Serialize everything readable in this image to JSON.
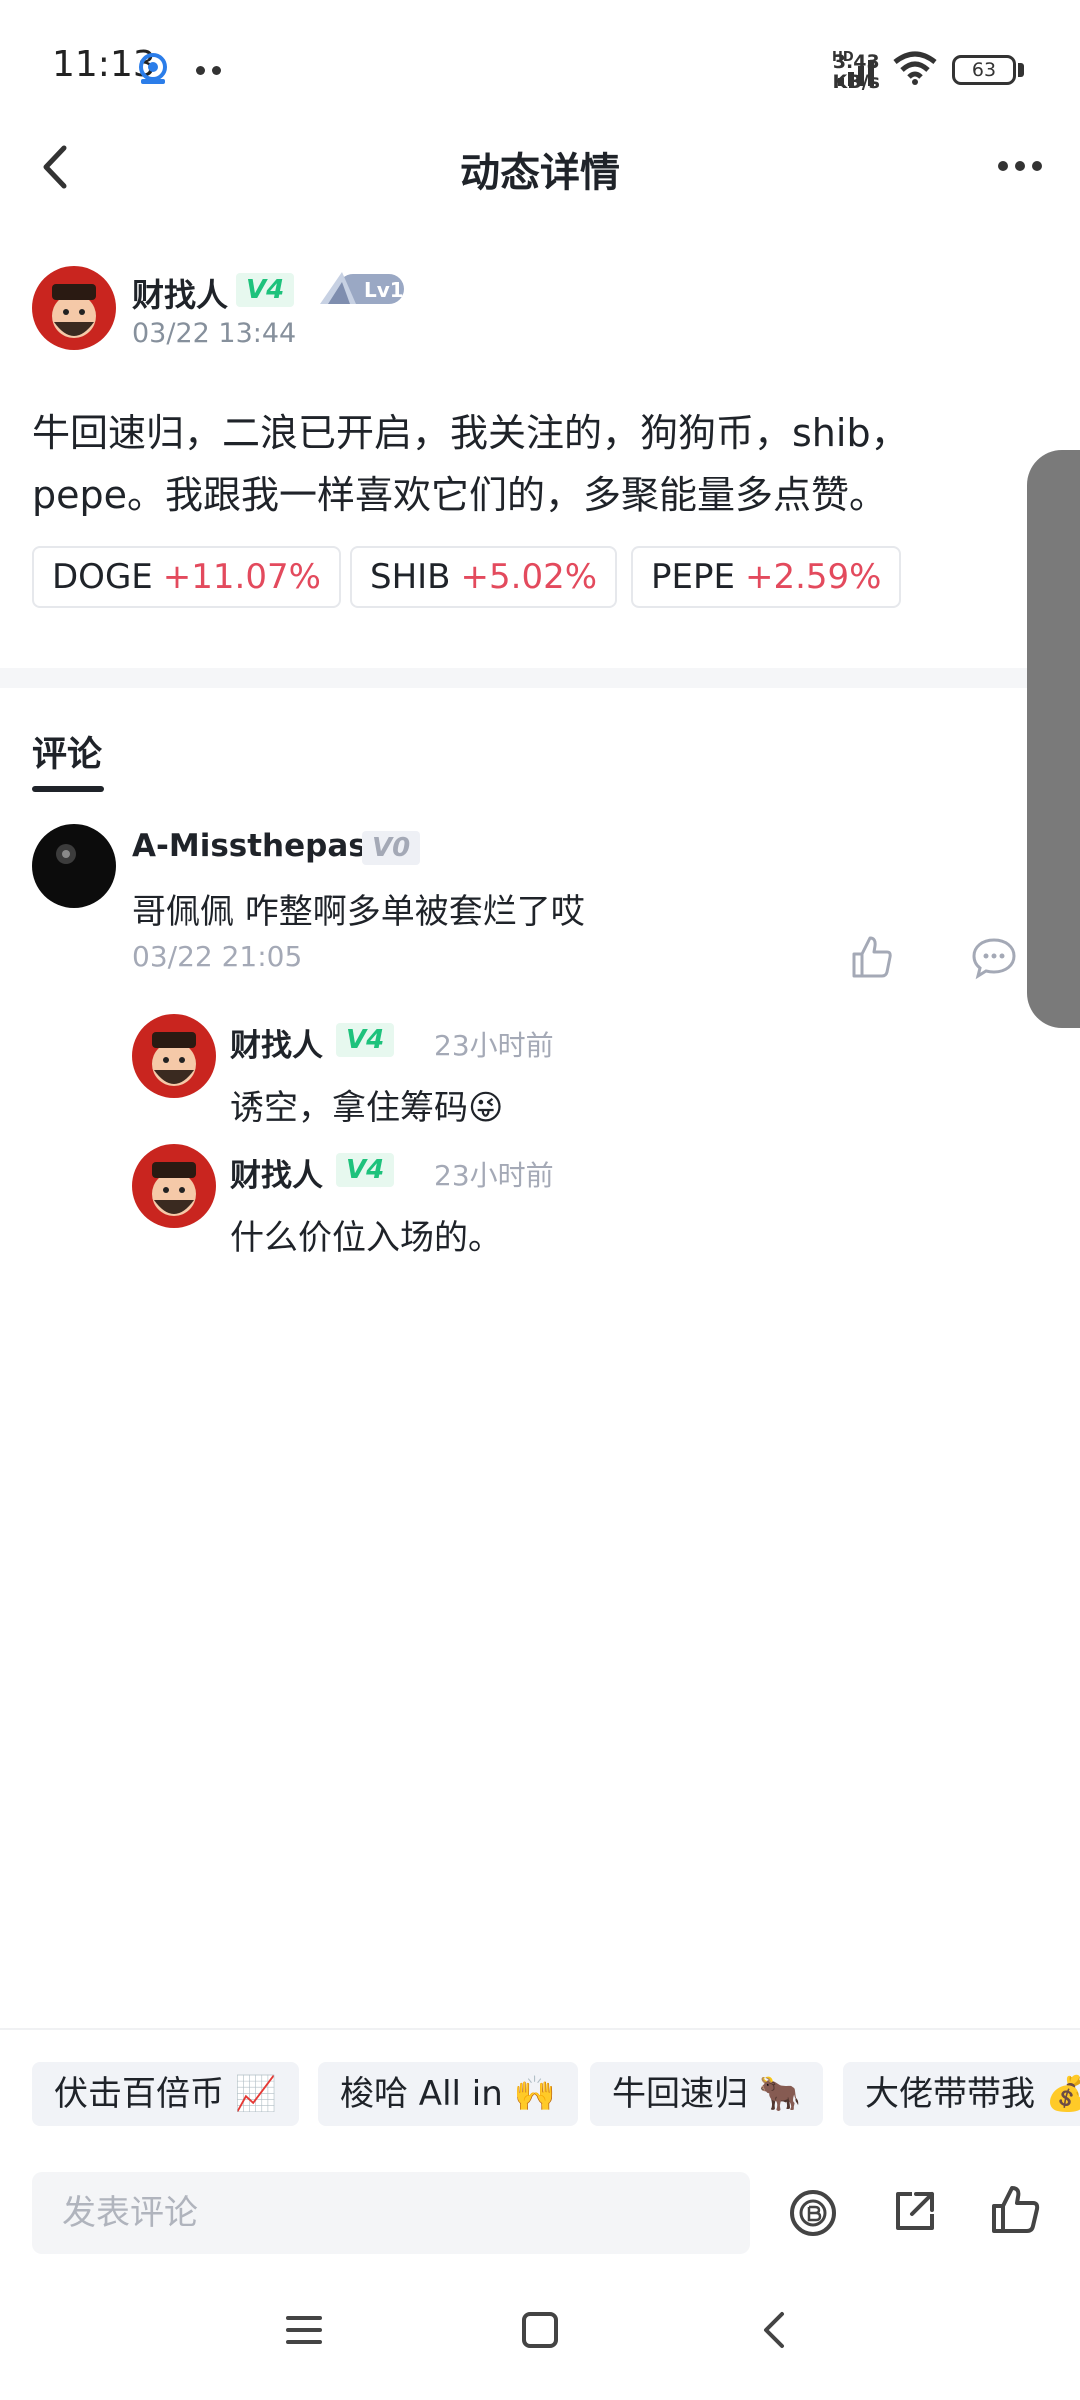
{
  "status_bar": {
    "time": "11:13",
    "net_speed_value": "3.43",
    "net_speed_unit": "KB/s",
    "hd": "HD",
    "battery": "63"
  },
  "header": {
    "title": "动态详情",
    "back_icon": "chevron-left-icon",
    "more_icon": "more-dots-icon"
  },
  "post": {
    "author": "财找人",
    "vip_badge": "V4",
    "level_badge": "Lv1",
    "time": "03/22 13:44",
    "content_line1": "牛回速归，二浪已开启，我关注的，狗狗币，shib，",
    "content_line2": "pepe。我跟我一样喜欢它们的，多聚能量多点赞。",
    "coins": [
      {
        "symbol": "DOGE",
        "change": "+11.07%"
      },
      {
        "symbol": "SHIB",
        "change": "+5.02%"
      },
      {
        "symbol": "PEPE",
        "change": "+2.59%"
      }
    ],
    "accent_up_color": "#e34a5d"
  },
  "comments_tab": "评论",
  "comments": [
    {
      "author": "A-Missthepas",
      "badge": "V0",
      "text": "哥佩佩 咋整啊多单被套烂了哎",
      "time": "03/22 21:05",
      "replies": [
        {
          "author": "财找人",
          "badge": "V4",
          "time": "23小时前",
          "text": "诱空，拿住筹码",
          "emoji": "😜"
        },
        {
          "author": "财找人",
          "badge": "V4",
          "time": "23小时前",
          "text": "什么价位入场的。"
        }
      ]
    }
  ],
  "hashtags": [
    {
      "label": "伏击百倍币",
      "emoji": "📈"
    },
    {
      "label": "梭哈 All in",
      "emoji": "🙌"
    },
    {
      "label": "牛回速归",
      "emoji": "🐂"
    },
    {
      "label": "大佬带带我",
      "emoji": "💰"
    }
  ],
  "comment_input": {
    "placeholder": "发表评论"
  }
}
